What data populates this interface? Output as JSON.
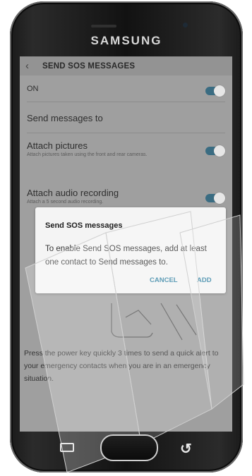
{
  "device": {
    "brand": "SAMSUNG"
  },
  "screen": {
    "header": {
      "back_icon": "back-arrow-icon",
      "title": "SEND SOS MESSAGES"
    },
    "settings": [
      {
        "label": "ON",
        "toggle": true
      },
      {
        "label": "Send messages to"
      },
      {
        "label": "Attach pictures",
        "sub": "Attach pictures taken using the front and rear cameras.",
        "toggle": true
      },
      {
        "label": "Attach audio recording",
        "sub": "Attach a 5 second audio recording.",
        "toggle": true
      }
    ],
    "instruction": "Press the power key quickly 3 times to send a quick alert to your emergency contacts when you are in an emergency situation."
  },
  "dialog": {
    "title": "Send SOS messages",
    "message": "To enable Send SOS messages, add at least one contact to Send messages to.",
    "cancel_label": "CANCEL",
    "add_label": "ADD"
  },
  "colors": {
    "accent": "#3a87a7",
    "toggle_on": "#3a6c82",
    "dim_overlay": "#9f9f9f"
  },
  "nav": {
    "recent_icon": "recent-apps-icon",
    "home_icon": "home-button-icon",
    "back_icon": "back-nav-icon"
  }
}
